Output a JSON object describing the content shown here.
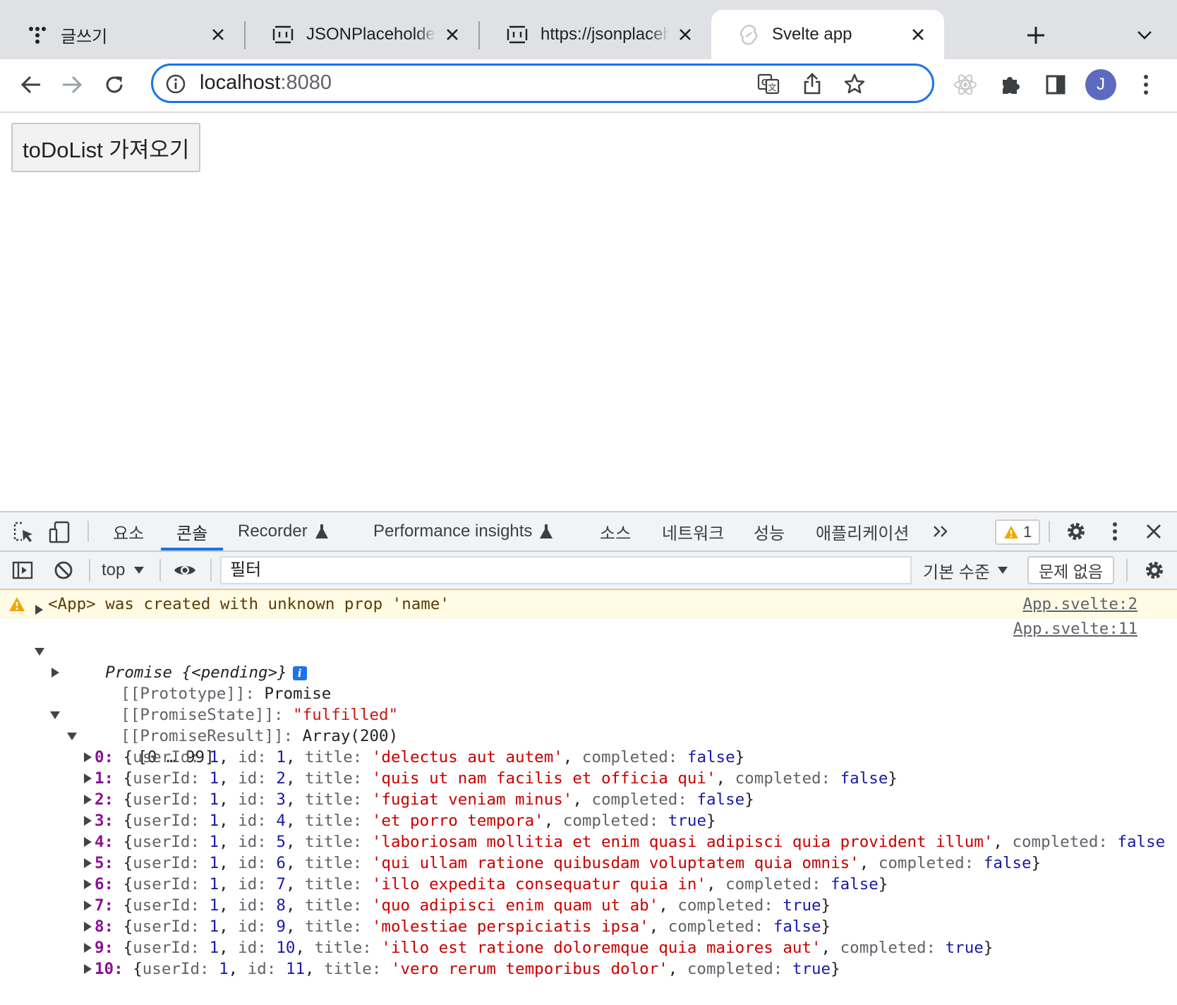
{
  "browser": {
    "tabs": [
      {
        "title": "글쓰기",
        "favicon": "dots-icon",
        "active": false
      },
      {
        "title": "JSONPlaceholder - Free Fake REST API",
        "favicon": "jsonplaceholder-icon",
        "active": false
      },
      {
        "title": "https://jsonplaceholder.typicode.com/todos",
        "favicon": "jsonplaceholder-icon",
        "active": false
      },
      {
        "title": "Svelte app",
        "favicon": "svelte-icon",
        "active": true
      }
    ],
    "url_host": "localhost",
    "url_port": ":8080",
    "profile_initial": "J"
  },
  "page": {
    "fetch_button_label": "toDoList 가져오기"
  },
  "devtools": {
    "tabs": [
      "요소",
      "콘솔",
      "Recorder",
      "Performance insights",
      "소스",
      "네트워크",
      "성능",
      "애플리케이션"
    ],
    "active_tab": "콘솔",
    "warning_count": "1",
    "context": "top",
    "filter_placeholder": "필터",
    "levels": "기본 수준",
    "issues": "문제 없음",
    "colors": {
      "accent": "#1a73e8",
      "warning_bg": "#fffbe5",
      "string": "#c41a16",
      "number": "#1a1aa6",
      "index": "#881391"
    }
  },
  "console": {
    "warning": {
      "message": "<App> was created with unknown prop 'name'",
      "source": "App.svelte:2"
    },
    "log_source": "App.svelte:11",
    "promise_header": "Promise {<pending>}",
    "prototype": {
      "key": "[[Prototype]]",
      "value": "Promise"
    },
    "state": {
      "key": "[[PromiseState]]",
      "value": "\"fulfilled\""
    },
    "result": {
      "key": "[[PromiseResult]]",
      "value": "Array(200)"
    },
    "range": "[0 … 99]",
    "items": [
      {
        "index": "0",
        "userId": "1",
        "id": "1",
        "title": "'delectus aut autem'",
        "completed": "false",
        "closing": "}"
      },
      {
        "index": "1",
        "userId": "1",
        "id": "2",
        "title": "'quis ut nam facilis et officia qui'",
        "completed": "false",
        "closing": "}"
      },
      {
        "index": "2",
        "userId": "1",
        "id": "3",
        "title": "'fugiat veniam minus'",
        "completed": "false",
        "closing": "}"
      },
      {
        "index": "3",
        "userId": "1",
        "id": "4",
        "title": "'et porro tempora'",
        "completed": "true",
        "closing": "}"
      },
      {
        "index": "4",
        "userId": "1",
        "id": "5",
        "title": "'laboriosam mollitia et enim quasi adipisci quia provident illum'",
        "completed": "false",
        "closing": ""
      },
      {
        "index": "5",
        "userId": "1",
        "id": "6",
        "title": "'qui ullam ratione quibusdam voluptatem quia omnis'",
        "completed": "false",
        "closing": "}"
      },
      {
        "index": "6",
        "userId": "1",
        "id": "7",
        "title": "'illo expedita consequatur quia in'",
        "completed": "false",
        "closing": "}"
      },
      {
        "index": "7",
        "userId": "1",
        "id": "8",
        "title": "'quo adipisci enim quam ut ab'",
        "completed": "true",
        "closing": "}"
      },
      {
        "index": "8",
        "userId": "1",
        "id": "9",
        "title": "'molestiae perspiciatis ipsa'",
        "completed": "false",
        "closing": "}"
      },
      {
        "index": "9",
        "userId": "1",
        "id": "10",
        "title": "'illo est ratione doloremque quia maiores aut'",
        "completed": "true",
        "closing": "}"
      },
      {
        "index": "10",
        "userId": "1",
        "id": "11",
        "title": "'vero rerum temporibus dolor'",
        "completed": "true",
        "closing": "}"
      }
    ]
  }
}
